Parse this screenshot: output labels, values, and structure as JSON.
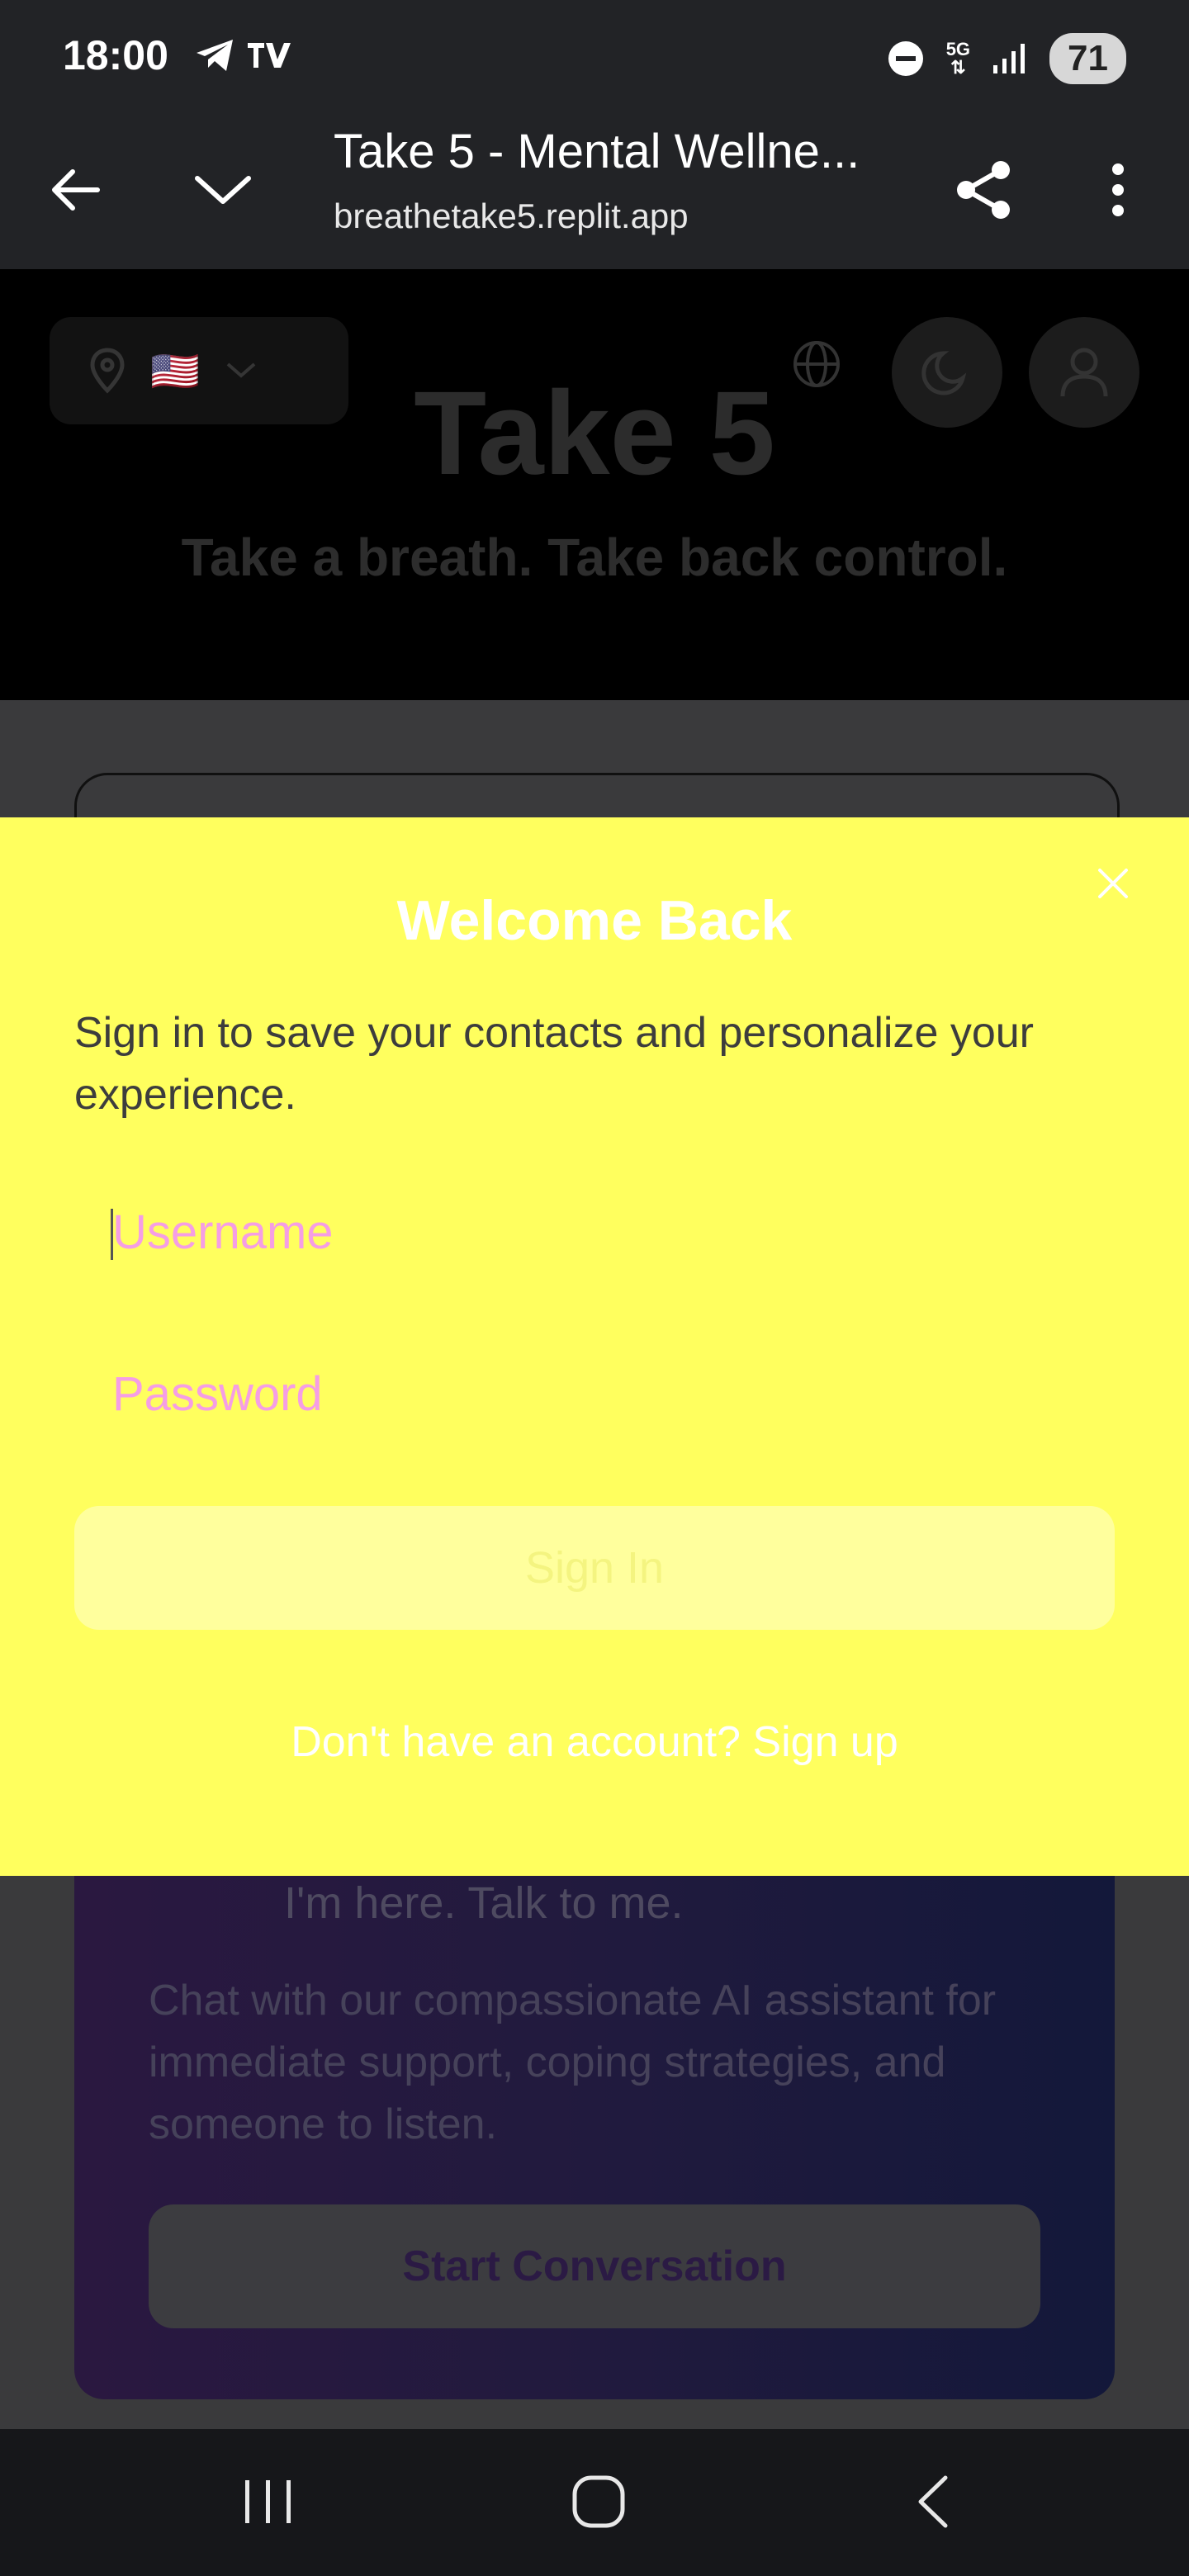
{
  "status_bar": {
    "time": "18:00",
    "network": "5G",
    "battery": "71"
  },
  "toolbar": {
    "page_title": "Take 5 - Mental Wellne...",
    "url": "breathetake5.replit.app"
  },
  "hero": {
    "title": "Take 5",
    "subtitle": "Take a breath. Take back control.",
    "flag": "🇺🇸"
  },
  "chat_card": {
    "heading": "I'm here. Talk to me.",
    "description": "Chat with our compassionate AI assistant for immediate support, coping strategies, and someone to listen.",
    "button_label": "Start Conversation"
  },
  "modal": {
    "title": "Welcome Back",
    "description": "Sign in to save your contacts and personalize your experience.",
    "username_placeholder": "Username",
    "password_placeholder": "Password",
    "signin_label": "Sign In",
    "signup_text": "Don't have an account? Sign up"
  },
  "colors": {
    "modal_bg": "#ffff5e",
    "placeholder": "#f59ee4",
    "signin_bg": "#ffff9d"
  }
}
